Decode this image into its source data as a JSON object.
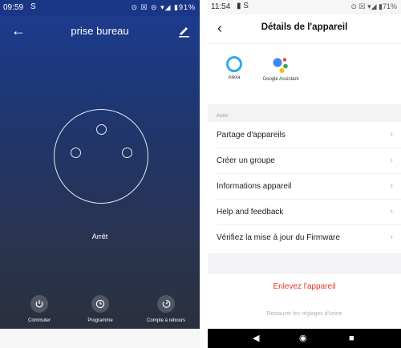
{
  "left_screen": {
    "status_bar": {
      "time": "09:59",
      "app_icon": "S",
      "indicators": "⊙ ☒ ⊝ ▾◢ ▮91%"
    },
    "header": {
      "title": "prise bureau",
      "back_icon": "arrow-left-icon",
      "edit_icon": "pencil-icon"
    },
    "outlet": {
      "icon": "socket-icon"
    },
    "state_label": "Arrêt",
    "controls": [
      {
        "label": "Commuter",
        "icon": "power-icon"
      },
      {
        "label": "Programme",
        "icon": "clock-icon"
      },
      {
        "label": "Compte à rebours",
        "icon": "timer-icon"
      }
    ],
    "colors": {
      "background_top": "#1d3c8f",
      "background_bottom": "#2a2f3a"
    }
  },
  "right_screen": {
    "status_bar": {
      "time": "11:54",
      "app_icons": "▮ S",
      "indicators": "⊙ ☒ ▾◢ ▮71%"
    },
    "header": {
      "title": "Détails de l'appareil",
      "back_icon": "chevron-left-icon"
    },
    "services": [
      {
        "label": "Alexa",
        "icon": "alexa-icon"
      },
      {
        "label": "Google Assistant",
        "icon": "google-assistant-icon"
      }
    ],
    "section_label": "Autre",
    "menu": [
      {
        "label": "Partage d'appareils"
      },
      {
        "label": "Créer un groupe"
      },
      {
        "label": "Informations appareil"
      },
      {
        "label": "Help and feedback"
      },
      {
        "label": "Vérifiez la mise à jour du Firmware"
      }
    ],
    "remove_label": "Enlevez l'appareil",
    "restore_label": "Restaurer les réglages d'usine",
    "colors": {
      "danger": "#e8362a",
      "alexa": "#2fa9e6"
    }
  }
}
